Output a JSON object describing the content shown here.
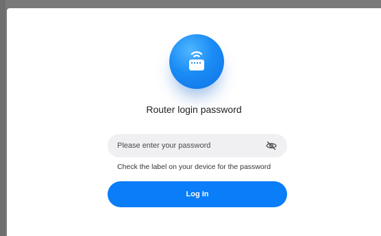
{
  "dialog": {
    "title": "Router login password",
    "password": {
      "value": "",
      "placeholder": "Please enter your password"
    },
    "hint": "Check the label on your device for the password",
    "login_label": "Log In"
  },
  "icons": {
    "badge": "router-wifi-icon",
    "toggle": "eye-slash-icon"
  },
  "colors": {
    "primary": "#0a7df8",
    "field_bg": "#f0f0f2",
    "backdrop": "#7a7a7a"
  }
}
